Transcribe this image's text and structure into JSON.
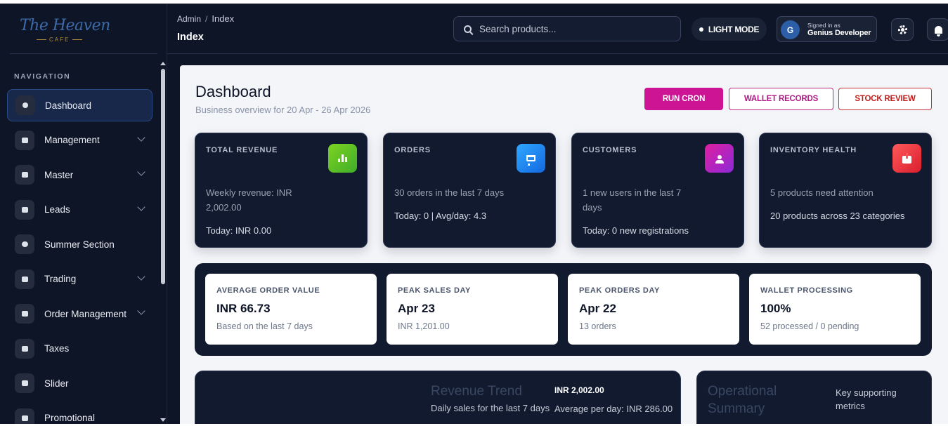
{
  "brand": {
    "name": "The Heaven",
    "sub": "CAFE"
  },
  "sidebar": {
    "heading": "NAVIGATION",
    "items": [
      {
        "label": "Dashboard",
        "active": true,
        "chevron": false
      },
      {
        "label": "Management",
        "chevron": true
      },
      {
        "label": "Master",
        "chevron": true
      },
      {
        "label": "Leads",
        "chevron": true
      },
      {
        "label": "Summer Section",
        "chevron": false
      },
      {
        "label": "Trading",
        "chevron": true
      },
      {
        "label": "Order Management",
        "chevron": true
      },
      {
        "label": "Taxes",
        "chevron": false
      },
      {
        "label": "Slider",
        "chevron": false
      },
      {
        "label": "Promotional",
        "chevron": false
      }
    ]
  },
  "topbar": {
    "breadcrumb": {
      "root": "Admin",
      "current": "Index"
    },
    "page_title": "Index",
    "search_placeholder": "Search products...",
    "theme_toggle": "LIGHT MODE",
    "user": {
      "initial": "G",
      "signed_in_label": "Signed in as",
      "name": "Genius Developer"
    }
  },
  "dashboard": {
    "title": "Dashboard",
    "subtitle": "Business overview for 20 Apr - 26 Apr 2026",
    "actions": {
      "run_cron": "RUN CRON",
      "wallet_records": "WALLET RECORDS",
      "stock_review": "STOCK REVIEW"
    },
    "kpis": {
      "revenue": {
        "label": "TOTAL REVENUE",
        "text": "Weekly revenue: INR 2,002.00",
        "foot": "Today: INR 0.00"
      },
      "orders": {
        "label": "ORDERS",
        "text": "30 orders in the last 7 days",
        "foot": "Today: 0 | Avg/day: 4.3"
      },
      "customers": {
        "label": "CUSTOMERS",
        "text": "1 new users in the last 7 days",
        "foot": "Today: 0 new registrations"
      },
      "inventory": {
        "label": "INVENTORY HEALTH",
        "text": "5 products need attention",
        "foot": "20 products across 23 categories"
      }
    },
    "metrics": {
      "aov": {
        "label": "AVERAGE ORDER VALUE",
        "value": "INR 66.73",
        "sub": "Based on the last 7 days"
      },
      "peak_sales": {
        "label": "PEAK SALES DAY",
        "value": "Apr 23",
        "sub": "INR 1,201.00"
      },
      "peak_orders": {
        "label": "PEAK ORDERS DAY",
        "value": "Apr 22",
        "sub": "13 orders"
      },
      "wallet": {
        "label": "WALLET PROCESSING",
        "value": "100%",
        "sub": "52 processed / 0 pending"
      }
    },
    "revenue_trend": {
      "title": "Revenue Trend",
      "subtitle": "Daily sales for the last 7 days",
      "total": "INR 2,002.00",
      "average": "Average per day: INR 286.00"
    },
    "operational": {
      "title": "Operational Summary",
      "subtitle": "Key supporting metrics"
    }
  },
  "colors": {
    "accent_magenta": "#cc1494",
    "stock_red": "#c01d1d",
    "sidebar_bg": "#0e1527",
    "card_bg": "#111a2e"
  },
  "icons": {
    "revenue": "bar-chart-icon",
    "orders": "cart-icon",
    "customers": "user-icon",
    "inventory": "box-icon"
  }
}
